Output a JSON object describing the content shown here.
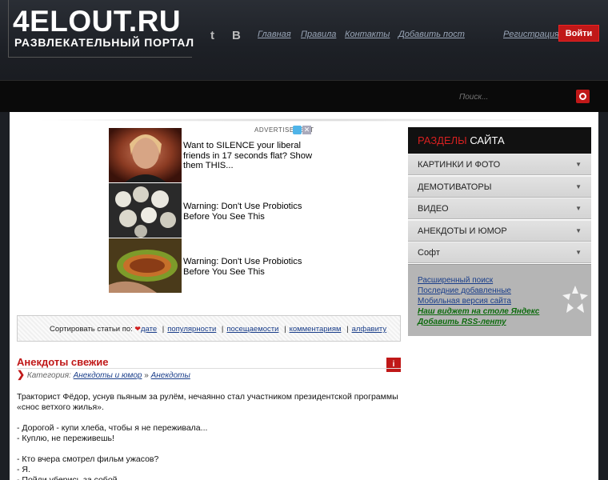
{
  "header": {
    "logo_title": "4ELOUT.RU",
    "logo_subtitle": "РАЗВЛЕКАТЕЛЬНЫЙ ПОРТАЛ",
    "social": {
      "twitter": "t",
      "vk": "B"
    },
    "nav": [
      "Главная",
      "Правила",
      "Контакты",
      "Добавить пост"
    ],
    "register": "Регистрация",
    "login": "Войти"
  },
  "search": {
    "placeholder": "Поиск..."
  },
  "ad": {
    "label": "ADVERTISEMENT",
    "close": "✕",
    "items": [
      {
        "text": "Want to SILENCE your liberal friends in 17 seconds flat? Show them THIS..."
      },
      {
        "text": "Warning: Don't Use Probiotics Before You See This"
      },
      {
        "text": "Warning: Don't Use Probiotics Before You See This"
      }
    ]
  },
  "sort": {
    "label": "Сортировать статьи по:",
    "options": [
      "дате",
      "популярности",
      "посещаемости",
      "комментариям",
      "алфавиту"
    ]
  },
  "article": {
    "title": "Анекдоты свежие",
    "category_label": "Категория:",
    "categories": [
      "Анекдоты и юмор",
      "Анекдоты"
    ],
    "category_sep": "»",
    "info": "i",
    "paragraphs": [
      "Тракторист Фёдор, уснув пьяным за рулём, нечаянно стал участником президентской программы «снос ветхого жилья».",
      "- Дорогой - купи хлеба, чтобы я не переживала...\n- Куплю, не переживешь!",
      "- Кто вчера смотрел фильм ужасов?\n- Я.\n- Пойди уберись за собой."
    ]
  },
  "sidebar": {
    "heading_red": "РАЗДЕЛЫ",
    "heading_white": "САЙТА",
    "items": [
      "КАРТИНКИ И ФОТО",
      "ДЕМОТИВАТОРЫ",
      "ВИДЕО",
      "АНЕКДОТЫ И ЮМОР",
      "Софт"
    ],
    "links": [
      "Расширенный поиск",
      "Последние добавленные",
      "Мобильная версия сайта"
    ],
    "green_links": [
      "Наш виджет на столе Яндекс",
      "Добавить RSS-ленту"
    ]
  },
  "colors": {
    "accent": "#c01818",
    "link": "#1a3e8a",
    "header_bg": "#1d2026"
  }
}
